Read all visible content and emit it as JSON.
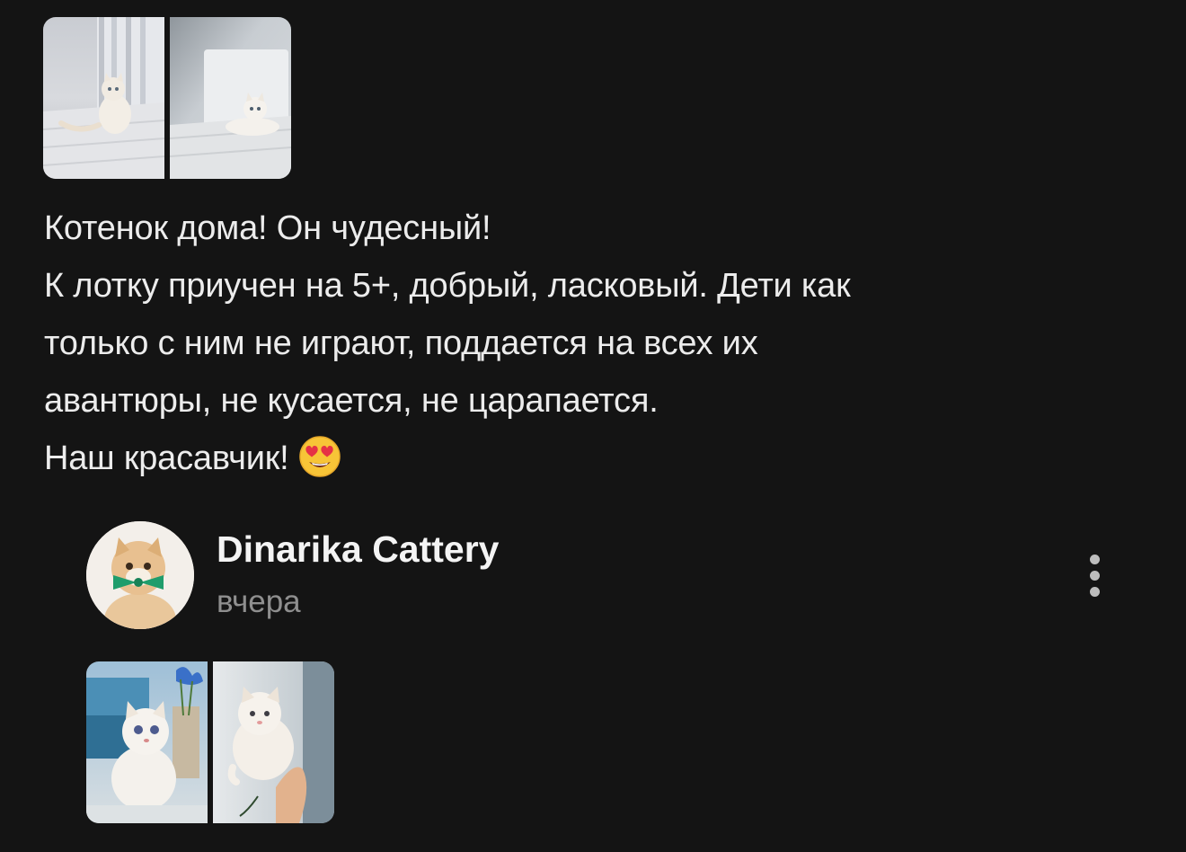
{
  "review": {
    "photos": [
      {
        "label": "kitten-on-bed-photo"
      },
      {
        "label": "kitten-lying-photo"
      }
    ],
    "lines": [
      "Котенок дома! Он чудесный!",
      "К лотку приучен на 5+, добрый, ласковый. Дети как",
      "только с ним не играют, поддается на всех их",
      "авантюры, не кусается, не царапается.",
      "Наш красавчик!"
    ],
    "emoji_icon": "heart-eyes-emoji-icon"
  },
  "reply": {
    "author": "Dinarika Cattery",
    "time": "вчера",
    "avatar_icon": "cat-with-bow-avatar",
    "menu_icon": "more-vertical-icon",
    "photos": [
      {
        "label": "white-kitten-sitting-photo"
      },
      {
        "label": "white-kitten-held-photo"
      }
    ]
  },
  "colors": {
    "background": "#141414",
    "text": "#ececec",
    "muted": "#8f8f8f"
  }
}
